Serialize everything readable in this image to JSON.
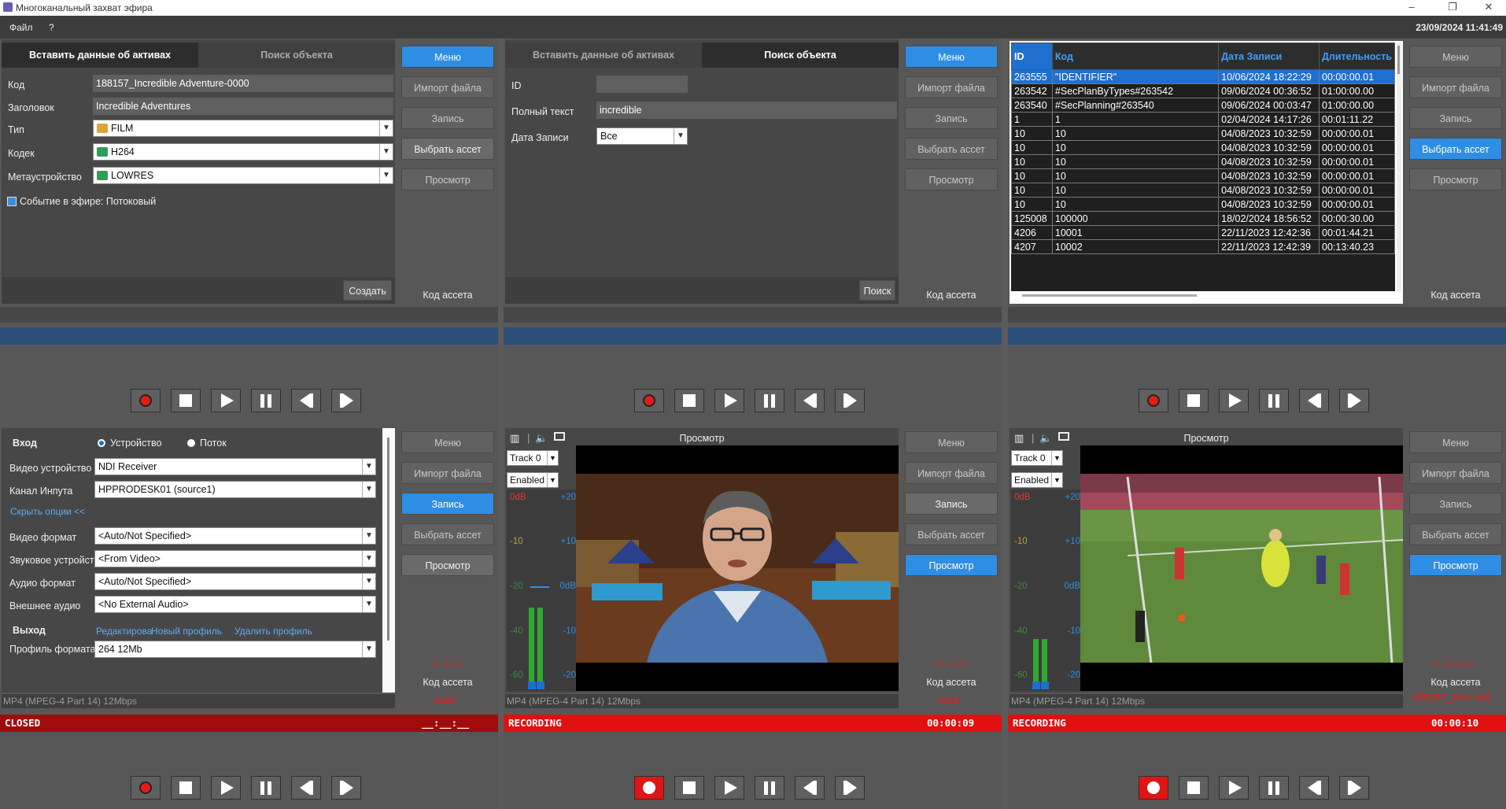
{
  "window": {
    "title": "Многоканальный захват эфира",
    "minimize": "–",
    "maximize": "❐",
    "close": "✕"
  },
  "menubar": {
    "file": "Файл",
    "help": "?",
    "clock": "23/09/2024 11:41:49"
  },
  "side": {
    "menu": "Меню",
    "import": "Импорт файла",
    "record": "Запись",
    "select": "Выбрать ассет",
    "preview": "Просмотр",
    "asset_code": "Код ассета"
  },
  "p1": {
    "tab_insert": "Вставить данные об активах",
    "tab_search": "Поиск объекта",
    "code_label": "Код",
    "code_value": "188157_Incredible Adventure-0000",
    "title_label": "Заголовок",
    "title_value": "Incredible Adventures",
    "type_label": "Тип",
    "type_value": "FILM",
    "codec_label": "Кодек",
    "codec_value": "H264",
    "meta_label": "Метаустройство",
    "meta_value": "LOWRES",
    "live_event": "Событие в эфире: Потоковый",
    "create": "Создать"
  },
  "p2": {
    "tab_insert": "Вставить данные об активах",
    "tab_search": "Поиск объекта",
    "id_label": "ID",
    "id_value": "",
    "fulltext_label": "Полный текст",
    "fulltext_value": "incredible",
    "date_label": "Дата Записи",
    "date_value": "Все",
    "search": "Поиск"
  },
  "p3": {
    "columns": [
      "ID",
      "Код",
      "Дата Записи",
      "Длительность"
    ],
    "rows": [
      [
        "263555",
        "\"IDENTIFIER\"",
        "10/06/2024 18:22:29",
        "00:00:00.01"
      ],
      [
        "263542",
        "#SecPlanByTypes#263542",
        "09/06/2024 00:36:52",
        "01:00:00.00"
      ],
      [
        "263540",
        "#SecPlanning#263540",
        "09/06/2024 00:03:47",
        "01:00:00.00"
      ],
      [
        "1",
        "1",
        "02/04/2024 14:17:26",
        "00:01:11.22"
      ],
      [
        "10",
        "10",
        "04/08/2023 10:32:59",
        "00:00:00.01"
      ],
      [
        "10",
        "10",
        "04/08/2023 10:32:59",
        "00:00:00.01"
      ],
      [
        "10",
        "10",
        "04/08/2023 10:32:59",
        "00:00:00.01"
      ],
      [
        "10",
        "10",
        "04/08/2023 10:32:59",
        "00:00:00.01"
      ],
      [
        "10",
        "10",
        "04/08/2023 10:32:59",
        "00:00:00.01"
      ],
      [
        "10",
        "10",
        "04/08/2023 10:32:59",
        "00:00:00.01"
      ],
      [
        "125008",
        "100000",
        "18/02/2024 18:56:52",
        "00:00:30.00"
      ],
      [
        "4206",
        "10001",
        "22/11/2023 12:42:36",
        "00:01:44.21"
      ],
      [
        "4207",
        "10002",
        "22/11/2023 12:42:39",
        "00:13:40.23"
      ]
    ]
  },
  "b1": {
    "input_label": "Вход",
    "opt_device": "Устройство",
    "opt_stream": "Поток",
    "video_dev_label": "Видео устройство",
    "video_dev_value": "NDI Receiver",
    "channel_label": "Канал Инпута",
    "channel_value": "HPPRODESK01 (source1)",
    "hide_options": "Скрыть опции <<",
    "video_fmt_label": "Видео формат",
    "video_fmt_value": "<Auto/Not Specified>",
    "audio_dev_label": "Звуковое устройство",
    "audio_dev_value": "<From Video>",
    "audio_fmt_label": "Аудио формат",
    "audio_fmt_value": "<Auto/Not Specified>",
    "ext_audio_label": "Внешнее аудио",
    "ext_audio_value": "<No External Audio>",
    "output_label": "Выход",
    "edit_link": "Редактирова",
    "new_profile": "Новый профиль",
    "delete_profile": "Удалить профиль",
    "profile_label": "Профиль формата",
    "profile_value": "264 12Mb",
    "id_small": "ID 2122",
    "code_red": "2122",
    "format": "MP4 (MPEG-4 Part 14) 12Mbps",
    "status": "CLOSED",
    "time": "__:__:__"
  },
  "b2": {
    "preview_title": "Просмотр",
    "track": "Track 0",
    "enabled": "Enabled",
    "vu": {
      "l0": "0dB",
      "r0": "+20",
      "l1": "-10",
      "r1": "+10",
      "l2": "-20",
      "r2": "0dB",
      "l3": "-40",
      "r3": "-10",
      "l4": "-60",
      "r4": "-20"
    },
    "id_small": "ID 2122",
    "code_red": "2122",
    "format": "MP4 (MPEG-4 Part 14) 12Mbps",
    "status": "RECORDING",
    "time": "00:00:09"
  },
  "b3": {
    "preview_title": "Просмотр",
    "track": "Track 0",
    "enabled": "Enabled",
    "vu": {
      "l0": "0dB",
      "r0": "+20",
      "l1": "-10",
      "r1": "+10",
      "l2": "-20",
      "r2": "0dB",
      "l3": "-40",
      "r3": "-10",
      "l4": "-60",
      "r4": "-20"
    },
    "id_small": "ID 263555",
    "code_red": "188157_Incredi",
    "format": "MP4 (MPEG-4 Part 14) 12Mbps",
    "status": "RECORDING",
    "time": "00:00:10"
  },
  "colors": {
    "accent": "#2e8ee3",
    "record_red": "#e01010",
    "status_blue": "#2b4f79"
  }
}
